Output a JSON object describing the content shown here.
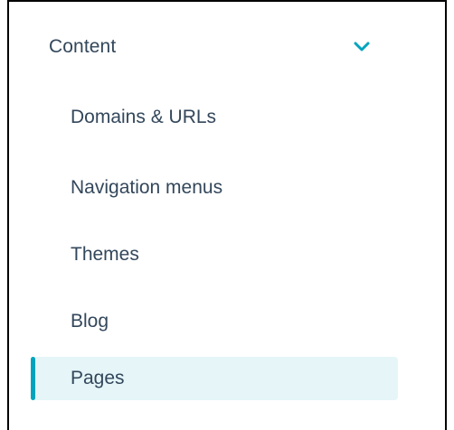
{
  "sidebar": {
    "section": {
      "title": "Content",
      "icon": "chevron-down-icon",
      "expanded": true
    },
    "items": [
      {
        "label": "Domains & URLs",
        "active": false
      },
      {
        "label": "Navigation menus",
        "active": false
      },
      {
        "label": "Themes",
        "active": false
      },
      {
        "label": "Blog",
        "active": false
      },
      {
        "label": "Pages",
        "active": true
      }
    ]
  },
  "colors": {
    "text": "#33475b",
    "accent": "#00a4bd",
    "active_bg": "#e5f5f8",
    "border": "#000000"
  }
}
